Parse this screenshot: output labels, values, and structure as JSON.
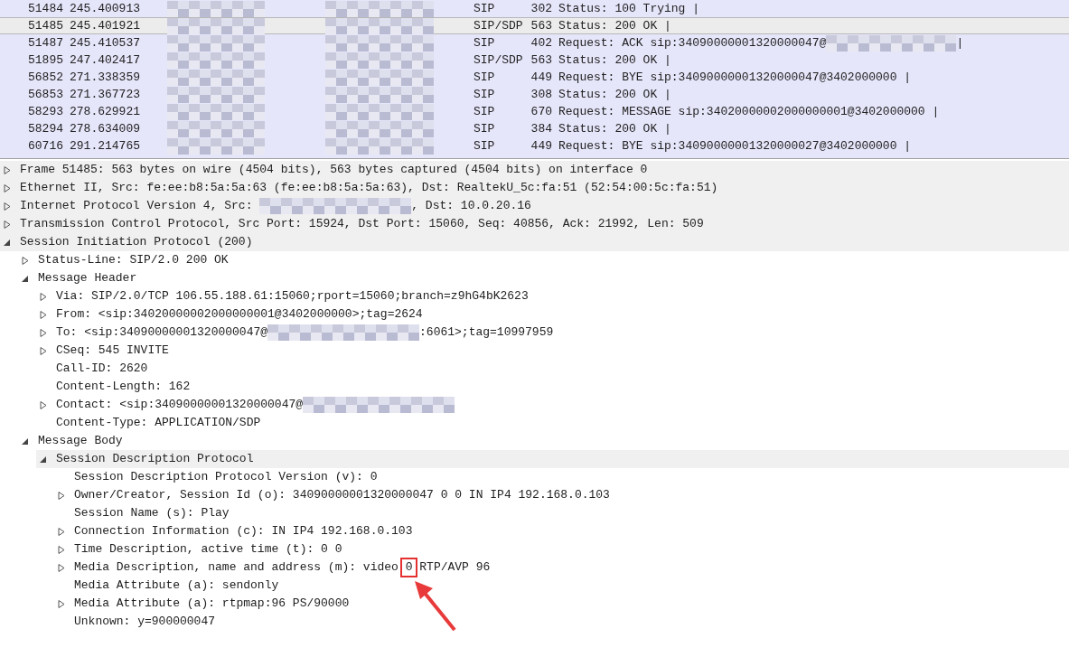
{
  "packet_list": [
    {
      "no": "51484",
      "time": "245.400913",
      "source": {
        "redacted": true
      },
      "destination": {
        "redacted": true
      },
      "protocol": "SIP",
      "length": "302",
      "info": [
        {
          "text": "Status: 100 Trying |"
        }
      ],
      "selected": false
    },
    {
      "no": "51485",
      "time": "245.401921",
      "source": {
        "redacted": true
      },
      "destination": {
        "redacted": true
      },
      "protocol": "SIP/SDP",
      "length": "563",
      "info": [
        {
          "text": "Status: 200 OK |"
        }
      ],
      "selected": true
    },
    {
      "no": "51487",
      "time": "245.410537",
      "source": {
        "redacted": true
      },
      "destination": {
        "redacted": true
      },
      "protocol": "SIP",
      "length": "402",
      "info": [
        {
          "text": "Request: ACK sip:34090000001320000047@"
        },
        {
          "redacted": true
        },
        {
          "text": "|"
        }
      ],
      "selected": false
    },
    {
      "no": "51895",
      "time": "247.402417",
      "source": {
        "redacted": true
      },
      "destination": {
        "redacted": true
      },
      "protocol": "SIP/SDP",
      "length": "563",
      "info": [
        {
          "text": "Status: 200 OK |"
        }
      ],
      "selected": false
    },
    {
      "no": "56852",
      "time": "271.338359",
      "source": {
        "redacted": true
      },
      "destination": {
        "redacted": true
      },
      "protocol": "SIP",
      "length": "449",
      "info": [
        {
          "text": "Request: BYE sip:34090000001320000047@3402000000 |"
        }
      ],
      "selected": false
    },
    {
      "no": "56853",
      "time": "271.367723",
      "source": {
        "redacted": true
      },
      "destination": {
        "redacted": true
      },
      "protocol": "SIP",
      "length": "308",
      "info": [
        {
          "text": "Status: 200 OK |"
        }
      ],
      "selected": false
    },
    {
      "no": "58293",
      "time": "278.629921",
      "source": {
        "redacted": true
      },
      "destination": {
        "redacted": true
      },
      "protocol": "SIP",
      "length": "670",
      "info": [
        {
          "text": "Request: MESSAGE sip:34020000002000000001@3402000000 |"
        }
      ],
      "selected": false
    },
    {
      "no": "58294",
      "time": "278.634009",
      "source": {
        "redacted": true
      },
      "destination": {
        "redacted": true
      },
      "protocol": "SIP",
      "length": "384",
      "info": [
        {
          "text": "Status: 200 OK |"
        }
      ],
      "selected": false
    },
    {
      "no": "60716",
      "time": "291.214765",
      "source": {
        "redacted": true
      },
      "destination": {
        "redacted": true
      },
      "protocol": "SIP",
      "length": "449",
      "info": [
        {
          "text": "Request: BYE sip:34090000001320000027@3402000000 |"
        }
      ],
      "selected": false
    }
  ],
  "packet_details": [
    {
      "parts": [
        {
          "text": "Frame 51485: 563 bytes on wire (4504 bits), 563 bytes captured (4504 bits) on interface 0"
        }
      ],
      "expanded": false,
      "shaded": true
    },
    {
      "parts": [
        {
          "text": "Ethernet II, Src: fe:ee:b8:5a:5a:63 (fe:ee:b8:5a:5a:63), Dst: RealtekU_5c:fa:51 (52:54:00:5c:fa:51)"
        }
      ],
      "expanded": false,
      "shaded": true
    },
    {
      "parts": [
        {
          "text": "Internet Protocol Version 4, Src: "
        },
        {
          "redacted": true
        },
        {
          "text": ", Dst: 10.0.20.16"
        }
      ],
      "expanded": false,
      "shaded": true
    },
    {
      "parts": [
        {
          "text": "Transmission Control Protocol, Src Port: 15924, Dst Port: 15060, Seq: 40856, Ack: 21992, Len: 509"
        }
      ],
      "expanded": false,
      "shaded": true
    },
    {
      "parts": [
        {
          "text": "Session Initiation Protocol (200)"
        }
      ],
      "expanded": true,
      "shaded": true,
      "children": [
        {
          "parts": [
            {
              "text": "Status-Line: SIP/2.0 200 OK"
            }
          ],
          "expanded": false
        },
        {
          "parts": [
            {
              "text": "Message Header"
            }
          ],
          "expanded": true,
          "children": [
            {
              "parts": [
                {
                  "text": "Via: SIP/2.0/TCP 106.55.188.61:15060;rport=15060;branch=z9hG4bK2623"
                }
              ],
              "expanded": false
            },
            {
              "parts": [
                {
                  "text": "From: <sip:34020000002000000001@3402000000>;tag=2624"
                }
              ],
              "expanded": false
            },
            {
              "parts": [
                {
                  "text": "To: <sip:34090000001320000047@"
                },
                {
                  "redacted": true
                },
                {
                  "text": ":6061>;tag=10997959"
                }
              ],
              "expanded": false
            },
            {
              "parts": [
                {
                  "text": "CSeq: 545 INVITE"
                }
              ],
              "expanded": false
            },
            {
              "parts": [
                {
                  "text": "Call-ID: 2620"
                }
              ]
            },
            {
              "parts": [
                {
                  "text": "Content-Length: 162"
                }
              ]
            },
            {
              "parts": [
                {
                  "text": "Contact: <sip:34090000001320000047@"
                },
                {
                  "redacted": true
                }
              ],
              "expanded": false
            },
            {
              "parts": [
                {
                  "text": "Content-Type: APPLICATION/SDP"
                }
              ]
            }
          ]
        },
        {
          "parts": [
            {
              "text": "Message Body"
            }
          ],
          "expanded": true,
          "children": [
            {
              "parts": [
                {
                  "text": "Session Description Protocol"
                }
              ],
              "expanded": true,
              "shaded": true,
              "children": [
                {
                  "parts": [
                    {
                      "text": "Session Description Protocol Version (v): 0"
                    }
                  ]
                },
                {
                  "parts": [
                    {
                      "text": "Owner/Creator, Session Id (o): 34090000001320000047 0 0 IN IP4 192.168.0.103"
                    }
                  ],
                  "expanded": false
                },
                {
                  "parts": [
                    {
                      "text": "Session Name (s): Play"
                    }
                  ]
                },
                {
                  "parts": [
                    {
                      "text": "Connection Information (c): IN IP4 192.168.0.103"
                    }
                  ],
                  "expanded": false
                },
                {
                  "parts": [
                    {
                      "text": "Time Description, active time (t): 0 0"
                    }
                  ],
                  "expanded": false
                },
                {
                  "parts": [
                    {
                      "text": "Media Description, name and address (m): video "
                    },
                    {
                      "text": "0",
                      "boxed": true
                    },
                    {
                      "text": " RTP/AVP 96"
                    }
                  ],
                  "expanded": false
                },
                {
                  "parts": [
                    {
                      "text": "Media Attribute (a): sendonly"
                    }
                  ]
                },
                {
                  "parts": [
                    {
                      "text": "Media Attribute (a): rtpmap:96 PS/90000"
                    }
                  ],
                  "expanded": false
                },
                {
                  "parts": [
                    {
                      "text": "Unknown: y=900000047"
                    }
                  ]
                }
              ]
            }
          ]
        }
      ]
    }
  ]
}
